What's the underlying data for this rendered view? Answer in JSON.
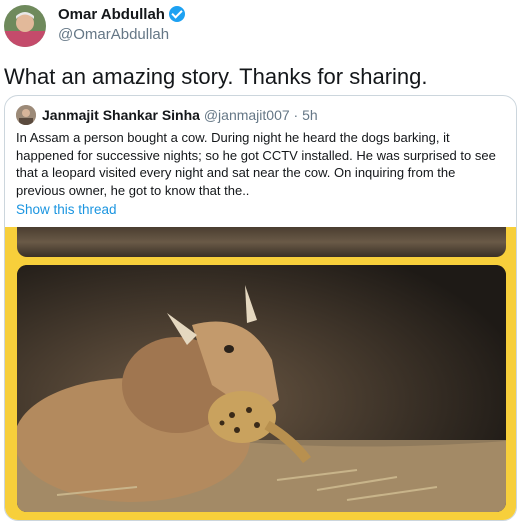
{
  "author": {
    "name": "Omar Abdullah",
    "handle": "@OmarAbdullah",
    "verified_icon": "verified-badge-icon"
  },
  "tweet": {
    "text": "What an amazing story. Thanks for sharing."
  },
  "quoted": {
    "name": "Janmajit Shankar Sinha",
    "handle": "@janmajit007",
    "separator": " · ",
    "time": "5h",
    "text": "In Assam a person bought a cow. During night he heard the dogs barking, it happened for successive nights; so he got CCTV installed. He was surprised to see that a leopard visited every night and sat near the cow. On inquiring from the previous owner, he got to know that the..",
    "show_thread": "Show this thread"
  },
  "colors": {
    "link": "#1b95e0",
    "verified": "#1da1f2",
    "photo_border": "#f7cf3b"
  }
}
